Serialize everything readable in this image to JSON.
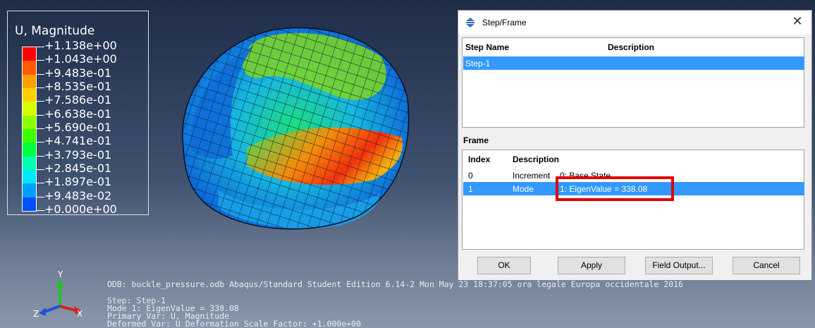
{
  "legend": {
    "title": "U, Magnitude",
    "labels": [
      "+1.138e+00",
      "+1.043e+00",
      "+9.483e-01",
      "+8.535e-01",
      "+7.586e-01",
      "+6.638e-01",
      "+5.690e-01",
      "+4.741e-01",
      "+3.793e-01",
      "+2.845e-01",
      "+1.897e-01",
      "+9.483e-02",
      "+0.000e+00"
    ],
    "colors": [
      "#ff0000",
      "#ff5a00",
      "#ffa000",
      "#ffd000",
      "#d6ff00",
      "#8cff00",
      "#3cff00",
      "#00ff3c",
      "#00ffb0",
      "#00e6ff",
      "#00a0ff",
      "#0050ff",
      "#0000ff"
    ]
  },
  "triad": {
    "y": "Y",
    "z": "Z",
    "x": "X"
  },
  "info": {
    "odb_line": "ODB: buckle_pressure.odb    Abaqus/Standard Student Edition 6.14-2    Mon May 23 18:37:05 ora legale Europa occidentale 2016",
    "step_line": "Step: Step-1",
    "mode_line": "Mode        1: EigenValue =  338.08",
    "primary_line": "Primary Var: U, Magnitude",
    "deformed_line": "Deformed Var: U   Deformation Scale Factor: +1.000e+00"
  },
  "dialog": {
    "title": "Step/Frame",
    "close_glyph": "✕",
    "step_headers": {
      "name": "Step Name",
      "description": "Description"
    },
    "steps": [
      {
        "name": "Step-1",
        "description": ""
      }
    ],
    "frame_label": "Frame",
    "frame_headers": {
      "index": "Index",
      "description": "Description"
    },
    "frames": [
      {
        "index": "0",
        "type": "Increment",
        "desc": "0: Base State"
      },
      {
        "index": "1",
        "type": "Mode",
        "desc": "1: EigenValue =  338.08"
      }
    ],
    "buttons": {
      "ok": "OK",
      "apply": "Apply",
      "field_output": "Field Output...",
      "cancel": "Cancel"
    }
  },
  "colors": {
    "selection": "#3399ff",
    "highlight_box": "#e00000"
  }
}
